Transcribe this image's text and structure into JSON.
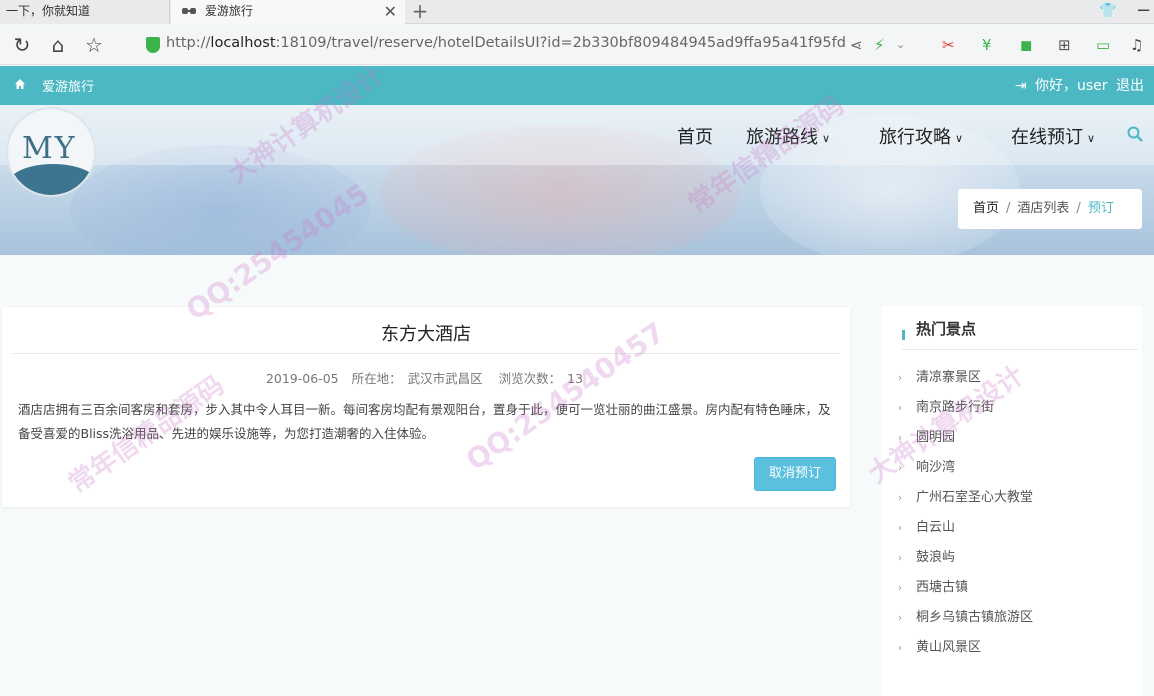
{
  "browser": {
    "tabs": [
      {
        "title": "一下，你就知道"
      },
      {
        "title": "爱游旅行"
      }
    ],
    "url_prefix": "http://",
    "url_host": "localhost",
    "url_rest": ":18109/travel/reserve/hotelDetailsUI?id=2b330bf809484945ad9ffa95a41f95fd"
  },
  "topbar": {
    "site_name": "爱游旅行",
    "greeting": "你好，user",
    "logout": "退出",
    "accent": "#4cb8c4"
  },
  "logo": {
    "text": "MY"
  },
  "nav": {
    "items": [
      {
        "label": "首页",
        "has_dropdown": false
      },
      {
        "label": "旅游路线",
        "has_dropdown": true
      },
      {
        "label": "旅行攻略",
        "has_dropdown": true
      },
      {
        "label": "在线预订",
        "has_dropdown": true
      }
    ]
  },
  "breadcrumb": {
    "home": "首页",
    "list": "酒店列表",
    "current": "预订",
    "separator": "/"
  },
  "hotel": {
    "name": "东方大酒店",
    "date": "2019-06-05",
    "location_label": "所在地：",
    "location": "武汉市武昌区",
    "views_label": "浏览次数：",
    "views": "13",
    "description": "酒店店拥有三百余间客房和套房，步入其中令人耳目一新。每间客房均配有景观阳台，置身于此，便可一览壮丽的曲江盛景。房内配有特色睡床，及备受喜爱的Bliss洗浴用品、先进的娱乐设施等，为您打造潮奢的入住体验。",
    "cancel_button": "取消预订",
    "button_color": "#5bc0de"
  },
  "sidebar": {
    "title": "热门景点",
    "items": [
      "清凉寨景区",
      "南京路步行街",
      "圆明园",
      "响沙湾",
      "广州石室圣心大教堂",
      "白云山",
      "鼓浪屿",
      "西塘古镇",
      "桐乡乌镇古镇旅游区",
      "黄山风景区"
    ]
  },
  "watermarks": [
    "QQ:25454045",
    "大神计算机设计",
    "常年信精品源码",
    "QQ:254540457",
    "常年信精品源码",
    "大神计算机设计"
  ]
}
